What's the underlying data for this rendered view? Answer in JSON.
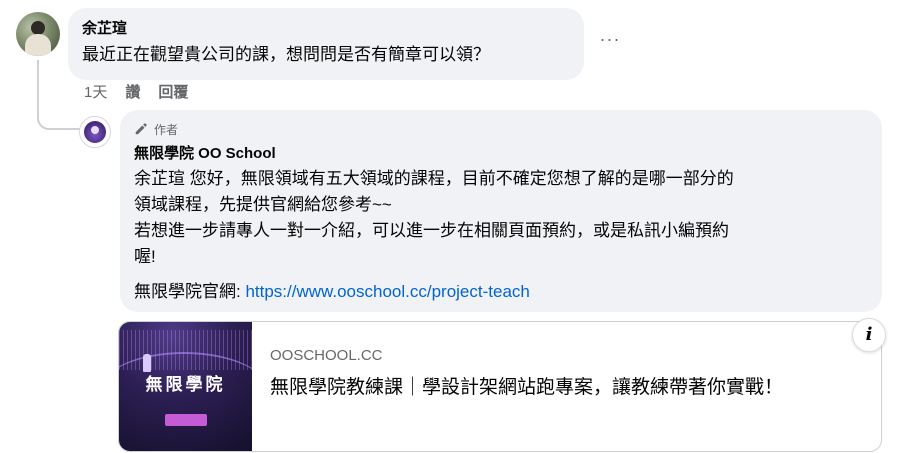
{
  "comment": {
    "author": "余芷瑄",
    "text": "最近正在觀望貴公司的課，想問問是否有簡章可以領？",
    "more_label": "···",
    "time": "1天",
    "like_label": "讚",
    "reply_label": "回覆"
  },
  "reply": {
    "badge": "作者",
    "author": "無限學院 OO School",
    "lines": [
      "余芷瑄 您好，無限領域有五大領域的課程，目前不確定您想了解的是哪一部分的",
      "領域課程，先提供官網給您參考~~",
      "若想進一步請專人一對一介紹，可以進一步在相關頁面預約，或是私訊小編預約",
      "喔!"
    ],
    "link_prefix": "無限學院官網: ",
    "link_url": "https://www.ooschool.cc/project-teach"
  },
  "preview": {
    "domain": "OOSCHOOL.CC",
    "title": "無限學院教練課｜學設計架網站跑專案，讓教練帶著你實戰！",
    "thumb_title": "無限學院",
    "info_label": "i"
  }
}
